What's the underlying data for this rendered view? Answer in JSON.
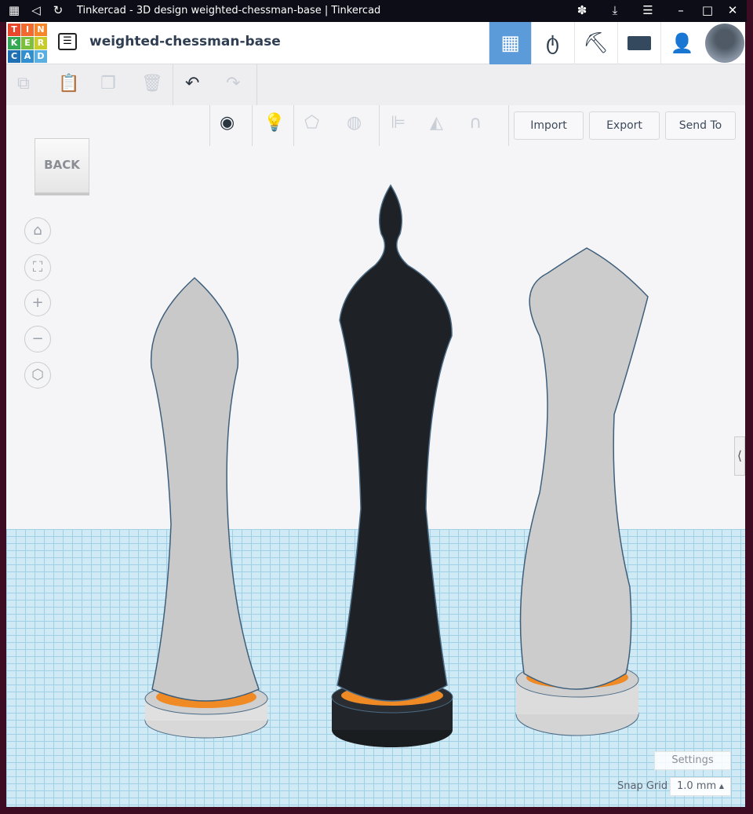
{
  "browser": {
    "title": "Tinkercad - 3D design weighted-chessman-base | Tinkercad"
  },
  "header": {
    "logo": [
      "T",
      "I",
      "N",
      "K",
      "E",
      "R",
      "C",
      "A",
      "D"
    ],
    "design_name": "weighted-chessman-base",
    "accent": "#5b9bd9"
  },
  "toolbar": {
    "import": "Import",
    "export": "Export",
    "send_to": "Send To"
  },
  "viewcube": {
    "label": "BACK"
  },
  "footer": {
    "settings": "Settings",
    "snap_grid_label": "Snap Grid",
    "snap_grid_value": "1.0 mm"
  }
}
